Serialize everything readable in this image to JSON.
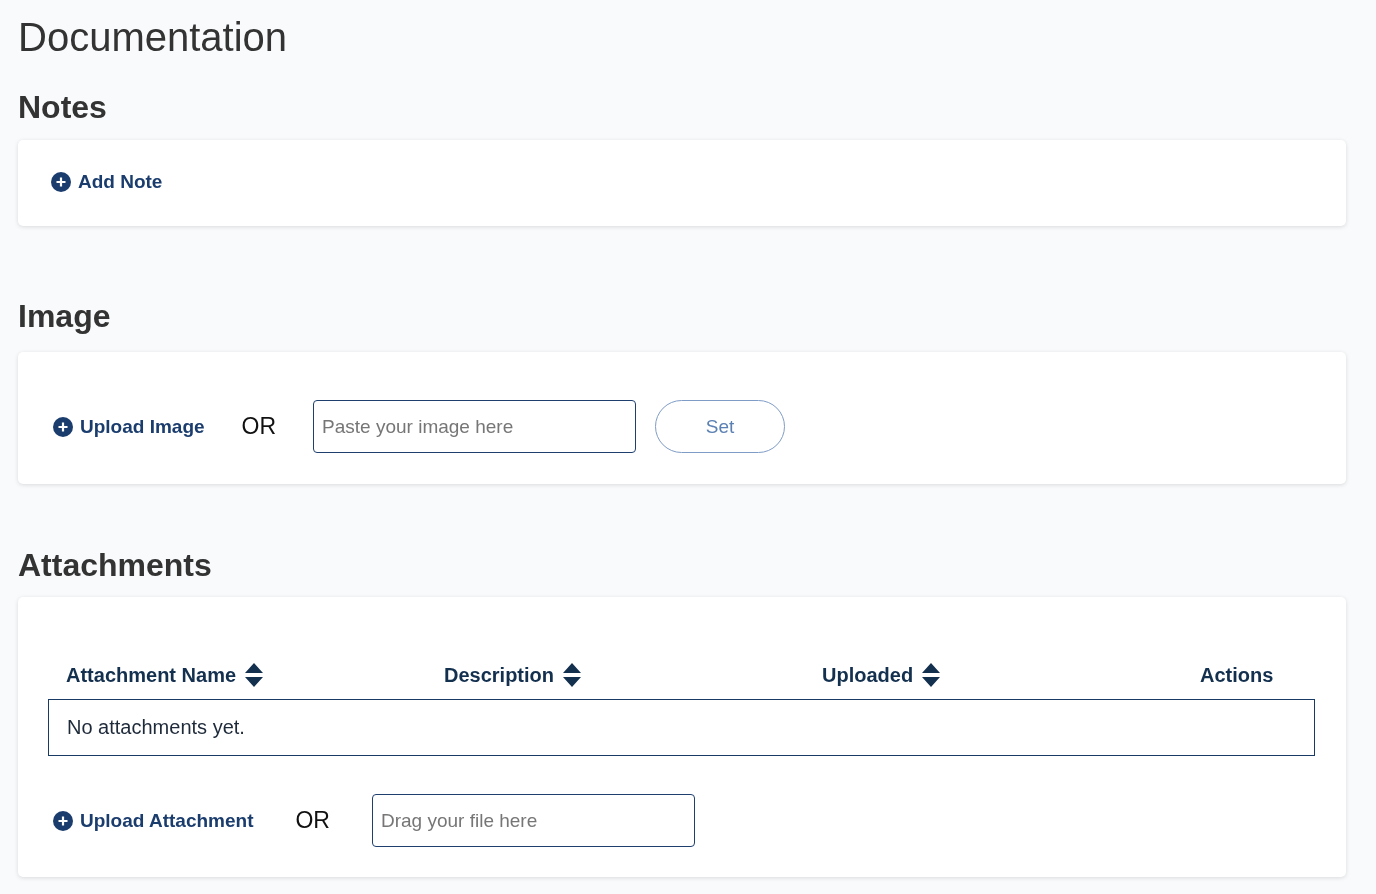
{
  "page": {
    "title": "Documentation"
  },
  "notes": {
    "heading": "Notes",
    "add_button": "Add Note"
  },
  "image": {
    "heading": "Image",
    "upload_button": "Upload Image",
    "separator": "OR",
    "paste_field": {
      "placeholder": "Paste your image here"
    },
    "set_button": "Set"
  },
  "attachments": {
    "heading": "Attachments",
    "table": {
      "columns": [
        {
          "label": "Attachment Name",
          "sortable": true
        },
        {
          "label": "Description",
          "sortable": true
        },
        {
          "label": "Uploaded",
          "sortable": true
        },
        {
          "label": "Actions",
          "sortable": false
        }
      ],
      "empty_message": "No attachments yet."
    },
    "upload_button": "Upload Attachment",
    "separator": "OR",
    "drop_field": {
      "placeholder": "Drag your file here"
    }
  }
}
